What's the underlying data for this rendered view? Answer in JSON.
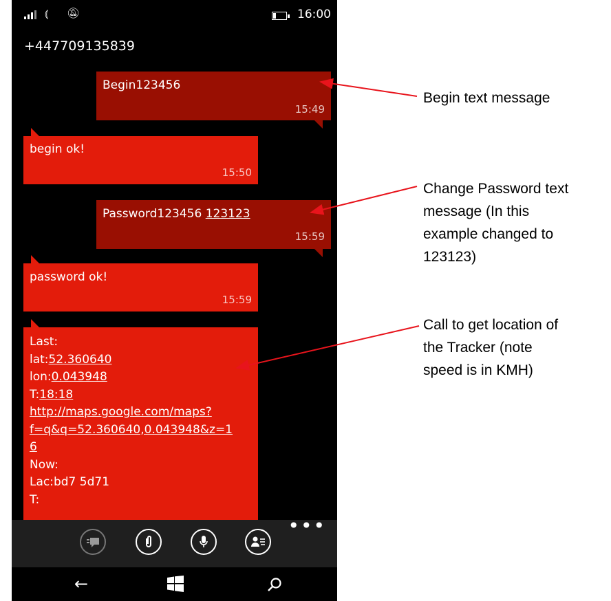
{
  "status": {
    "time": "16:00"
  },
  "contact": {
    "number": "+447709135839"
  },
  "messages": [
    {
      "dir": "out",
      "text": "Begin123456",
      "time": "15:49"
    },
    {
      "dir": "in",
      "text": "begin ok!",
      "time": "15:50"
    },
    {
      "dir": "out",
      "text_prefix": "Password123456 ",
      "text_link": "123123",
      "time": "15:59"
    },
    {
      "dir": "in",
      "text": "password ok!",
      "time": "15:59"
    },
    {
      "dir": "in",
      "line1": "Last:",
      "lat_label": "lat:",
      "lat_value": "52.360640",
      "lon_label": "lon:",
      "lon_value": "0.043948",
      "t_label": "T:",
      "t_value": "18:18",
      "url_1": "http://maps.google.com/maps?",
      "url_2": "f=q&q=52.360640,0.043948&z=1",
      "url_3": "6",
      "now": "Now:",
      "lac": "Lac:bd7 5d71",
      "t2": "T:"
    }
  ],
  "appbar": {
    "buttons": [
      "text-message-icon",
      "attach-icon",
      "microphone-icon",
      "contact-card-icon"
    ],
    "more": "•••"
  },
  "navbar": {
    "back": "←",
    "search": "⌕"
  },
  "annotations": [
    {
      "lines": [
        "Begin text message"
      ]
    },
    {
      "lines": [
        "Change Password text",
        "message (In this",
        "example changed to",
        "123123)"
      ]
    },
    {
      "lines": [
        "Call to get location of",
        "the Tracker (note",
        "speed is in KMH)"
      ]
    }
  ],
  "colors": {
    "outgoing": "#990f02",
    "incoming": "#e31c0b",
    "arrow": "#e8141c"
  }
}
